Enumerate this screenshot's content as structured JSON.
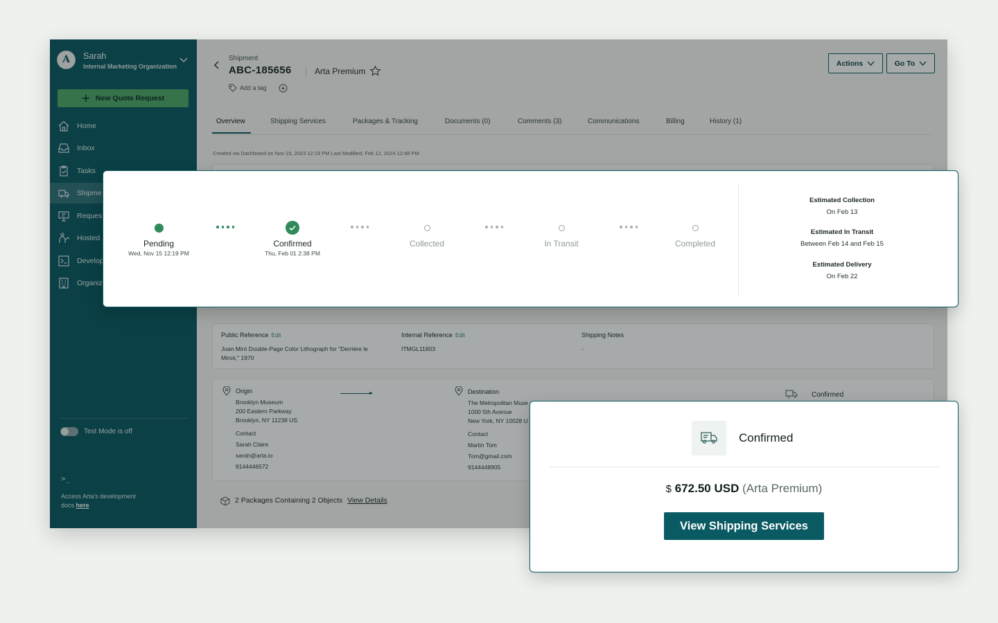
{
  "sidebar": {
    "user_name": "Sarah",
    "user_org": "Internal Marketing Organization",
    "new_quote_label": "New Quote Request",
    "nav": [
      {
        "label": "Home",
        "icon": "home-icon"
      },
      {
        "label": "Inbox",
        "icon": "inbox-icon"
      },
      {
        "label": "Tasks",
        "icon": "clipboard-icon"
      },
      {
        "label": "Shipme",
        "icon": "truck-icon"
      },
      {
        "label": "Reques",
        "icon": "monitor-icon"
      },
      {
        "label": "Hosted",
        "icon": "hosted-icon"
      },
      {
        "label": "Develop",
        "icon": "terminal-icon"
      },
      {
        "label": "Organiz",
        "icon": "building-icon"
      }
    ],
    "test_mode_label": "Test Mode is off",
    "terminal_glyph": ">_",
    "docs_text": "Access Arta's development docs",
    "docs_link": "here"
  },
  "header": {
    "crumb": "Shipment",
    "shipment_id": "ABC-185656",
    "service": "Arta Premium",
    "add_tag": "Add a tag",
    "actions_label": "Actions",
    "goto_label": "Go To"
  },
  "tabs": [
    "Overview",
    "Shipping Services",
    "Packages & Tracking",
    "Documents (0)",
    "Comments (3)",
    "Communications",
    "Billing",
    "History (1)"
  ],
  "meta": "Created via Dashboard on Nov 15, 2023 12:19 PM   Last Modified: Feb 12, 2024 12:48 PM",
  "references": {
    "public_label": "Public Reference",
    "public_value": "Joan Miró Double-Page Color Lithograph for \"Derrière le Miroir,\" 1970",
    "internal_label": "Internal Reference",
    "internal_value": "ITMGL11803",
    "notes_label": "Shipping Notes",
    "notes_value": "-",
    "edit_label": "Edit"
  },
  "origin": {
    "label": "Origin",
    "lines": [
      "Brooklyn Museum",
      "200 Eastern Parkway",
      "Brooklyn, NY 11238 US"
    ],
    "contact_label": "Contact",
    "contact_name": "Sarah Claire",
    "email": "sarah@arta.io",
    "phone": "9144446572"
  },
  "destination": {
    "label": "Destination",
    "lines": [
      "The Metropolitan Muse",
      "1000 5th Avenue",
      "New York, NY 10028 U"
    ],
    "contact_label": "Contact",
    "contact_name": "Martin Tom",
    "email": "Tom@gmail.com",
    "phone": "9144448905"
  },
  "status_small": "Confirmed",
  "packages": {
    "summary": "2 Packages Containing 2 Objects",
    "link": "View Details"
  },
  "tracker": {
    "steps": [
      {
        "label": "Pending",
        "date": "Wed, Nov 15 12:19 PM",
        "state": "done"
      },
      {
        "label": "Confirmed",
        "date": "Thu, Feb 01 2:38 PM",
        "state": "current"
      },
      {
        "label": "Collected",
        "date": "",
        "state": "todo"
      },
      {
        "label": "In Transit",
        "date": "",
        "state": "todo"
      },
      {
        "label": "Completed",
        "date": "",
        "state": "todo"
      }
    ],
    "estimates": [
      {
        "title": "Estimated Collection",
        "value": "On Feb 13"
      },
      {
        "title": "Estimated In Transit",
        "value": "Between Feb 14 and Feb 15"
      },
      {
        "title": "Estimated Delivery",
        "value": "On Feb 22"
      }
    ]
  },
  "quote": {
    "status": "Confirmed",
    "currency_symbol": "$",
    "amount": "672.50 USD",
    "service": "(Arta Premium)",
    "button_label": "View Shipping Services"
  },
  "colors": {
    "brand": "#0a5a63",
    "success": "#2f8a5c",
    "new_quote": "#4fa86a"
  }
}
